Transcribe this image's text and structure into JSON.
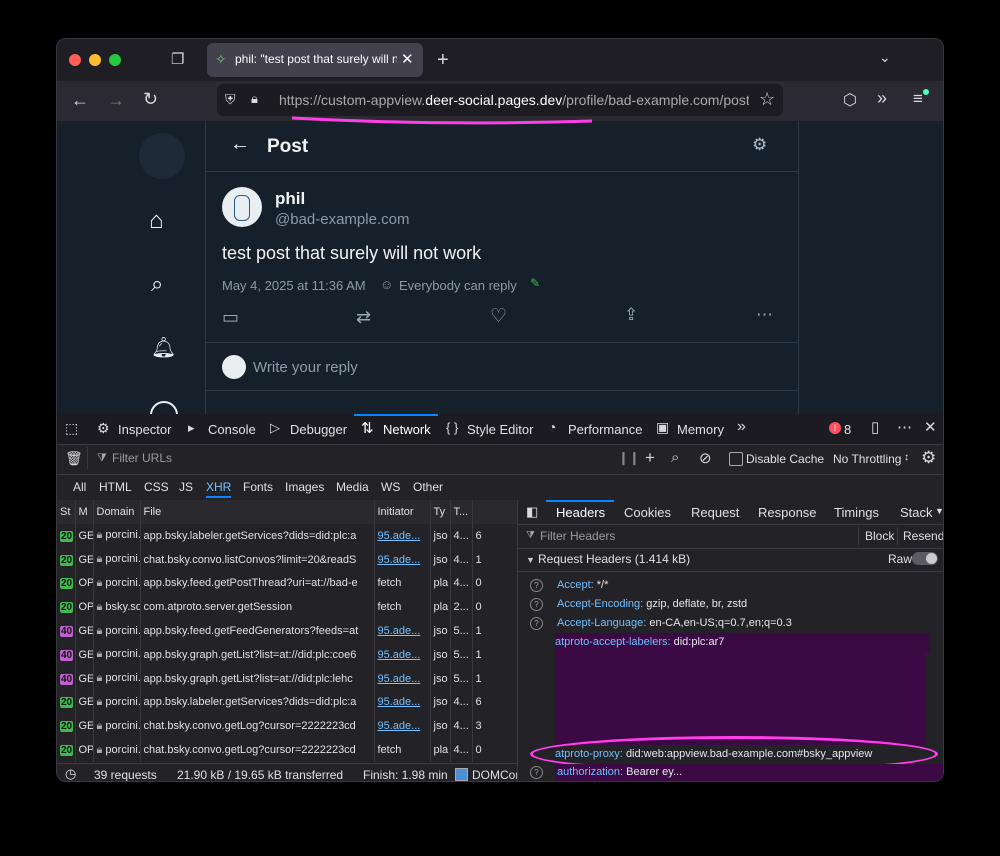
{
  "browser": {
    "tab_title": "phil: \"test post that surely will not work\"",
    "url_prefix": "https://custom-appview.",
    "url_host": "deer-social.pages.dev",
    "url_path": "/profile/bad-example.com/post"
  },
  "app": {
    "header_title": "Post",
    "author_name": "phil",
    "author_handle": "@bad-example.com",
    "post_text": "test post that surely will not work",
    "post_date": "May 4, 2025 at 11:36 AM",
    "reply_setting": "Everybody can reply",
    "reply_placeholder": "Write your reply"
  },
  "devtools": {
    "tabs": [
      "Inspector",
      "Console",
      "Debugger",
      "Network",
      "Style Editor",
      "Performance",
      "Memory"
    ],
    "error_count": "8",
    "filter_placeholder": "Filter URLs",
    "disable_cache": "Disable Cache",
    "throttling": "No Throttling",
    "types": [
      "All",
      "HTML",
      "CSS",
      "JS",
      "XHR",
      "Fonts",
      "Images",
      "Media",
      "WS",
      "Other"
    ],
    "columns": [
      "St",
      "M",
      "Domain",
      "File",
      "Initiator",
      "Ty",
      "T..."
    ],
    "rows": [
      {
        "status": "20",
        "method": "GE",
        "domain": "porcini....",
        "file": "app.bsky.labeler.getServices?dids=did:plc:a",
        "initiator": "95.ade...",
        "type": "jso",
        "t": "4...",
        "x": "6"
      },
      {
        "status": "20",
        "method": "GE",
        "domain": "porcini....",
        "file": "chat.bsky.convo.listConvos?limit=20&readS",
        "initiator": "95.ade...",
        "type": "jso",
        "t": "4...",
        "x": "1"
      },
      {
        "status": "20",
        "method": "OP",
        "domain": "porcini....",
        "file": "app.bsky.feed.getPostThread?uri=at://bad-e",
        "initiator": "fetch",
        "type": "pla",
        "t": "4...",
        "x": "0"
      },
      {
        "status": "20",
        "method": "OP",
        "domain": "bsky.so...",
        "file": "com.atproto.server.getSession",
        "initiator": "fetch",
        "type": "pla",
        "t": "2...",
        "x": "0"
      },
      {
        "status": "40",
        "method": "GE",
        "domain": "porcini....",
        "file": "app.bsky.feed.getFeedGenerators?feeds=at",
        "initiator": "95.ade...",
        "type": "jso",
        "t": "5...",
        "x": "1"
      },
      {
        "status": "40",
        "method": "GE",
        "domain": "porcini....",
        "file": "app.bsky.graph.getList?list=at://did:plc:coe6",
        "initiator": "95.ade...",
        "type": "jso",
        "t": "5...",
        "x": "1"
      },
      {
        "status": "40",
        "method": "GE",
        "domain": "porcini....",
        "file": "app.bsky.graph.getList?list=at://did:plc:lehc",
        "initiator": "95.ade...",
        "type": "jso",
        "t": "5...",
        "x": "1"
      },
      {
        "status": "20",
        "method": "GE",
        "domain": "porcini....",
        "file": "app.bsky.labeler.getServices?dids=did:plc:a",
        "initiator": "95.ade...",
        "type": "jso",
        "t": "4...",
        "x": "6"
      },
      {
        "status": "20",
        "method": "GE",
        "domain": "porcini....",
        "file": "chat.bsky.convo.getLog?cursor=2222223cd",
        "initiator": "95.ade...",
        "type": "jso",
        "t": "4...",
        "x": "3"
      },
      {
        "status": "20",
        "method": "OP",
        "domain": "porcini....",
        "file": "chat.bsky.convo.getLog?cursor=2222223cd",
        "initiator": "fetch",
        "type": "pla",
        "t": "4...",
        "x": "0"
      }
    ],
    "status": {
      "requests": "39 requests",
      "transferred": "21.90 kB / 19.65 kB transferred",
      "finish": "Finish: 1.98 min",
      "domcontent": "DOMCon"
    },
    "panel_tabs": [
      "Headers",
      "Cookies",
      "Request",
      "Response",
      "Timings",
      "Stack"
    ],
    "filter_headers": "Filter Headers",
    "block": "Block",
    "resend": "Resend",
    "section_title": "Request Headers (1.414 kB)",
    "raw": "Raw",
    "headers": [
      {
        "key": "Accept:",
        "value": "*/*"
      },
      {
        "key": "Accept-Encoding:",
        "value": "gzip, deflate, br, zstd"
      },
      {
        "key": "Accept-Language:",
        "value": "en-CA,en-US;q=0.7,en;q=0.3"
      },
      {
        "key": "atproto-accept-labelers:",
        "value": "did:plc:ar7"
      },
      {
        "key": "atproto-proxy:",
        "value": "did:web:appview.bad-example.com#bsky_appview"
      },
      {
        "key": "authorization:",
        "value": "Bearer ey..."
      }
    ]
  }
}
